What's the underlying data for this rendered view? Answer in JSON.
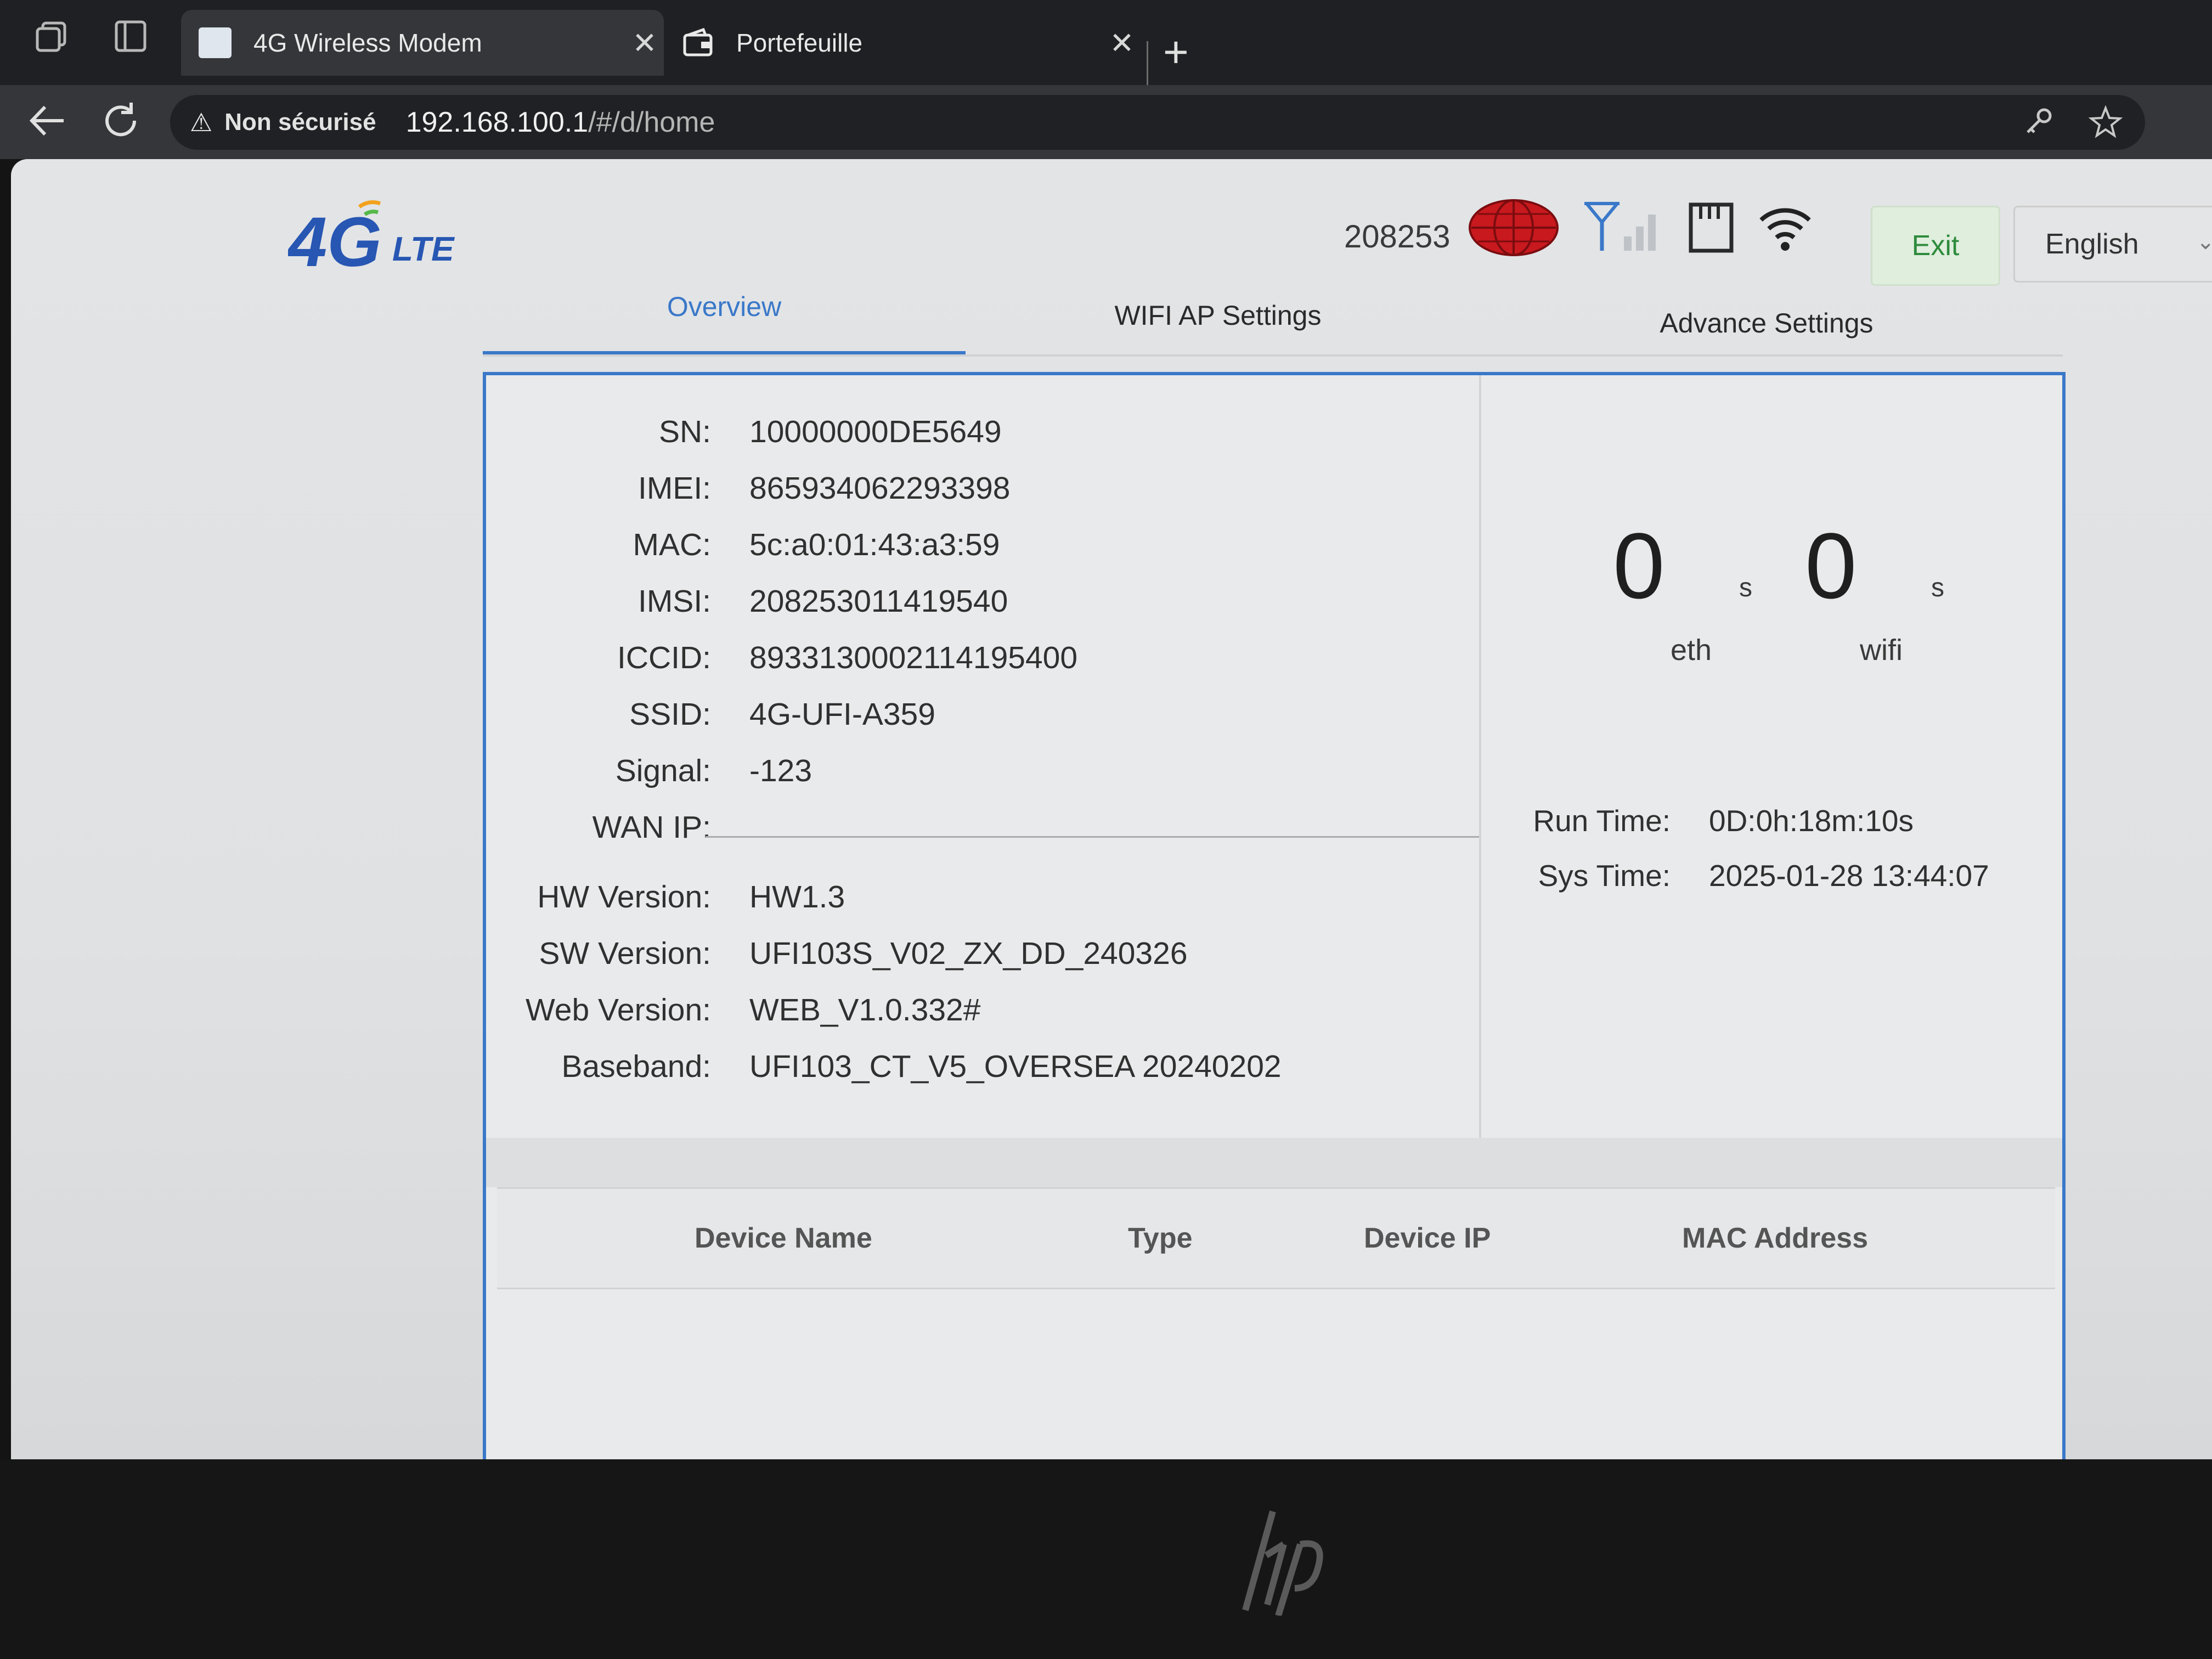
{
  "browser": {
    "tabs": [
      {
        "title": "4G Wireless Modem",
        "active": true
      },
      {
        "title": "Portefeuille",
        "active": false
      }
    ],
    "close_glyph": "✕",
    "new_tab_glyph": "+",
    "security_text": "Non sécurisé",
    "url_host": "192.168.100.1",
    "url_path": "/#/d/home"
  },
  "header": {
    "operator_code": "208253",
    "exit_label": "Exit",
    "language": "English",
    "icons": [
      "globe-icon",
      "signal-icon",
      "sim-card-icon",
      "wifi-icon"
    ]
  },
  "nav": {
    "tabs": [
      "Overview",
      "WIFI AP Settings",
      "Advance Settings"
    ],
    "active_tab": "Overview"
  },
  "device_info": {
    "rows": [
      {
        "label": "SN:",
        "value": "10000000DE5649"
      },
      {
        "label": "IMEI:",
        "value": "865934062293398"
      },
      {
        "label": "MAC:",
        "value": "5c:a0:01:43:a3:59"
      },
      {
        "label": "IMSI:",
        "value": "208253011419540"
      },
      {
        "label": "ICCID:",
        "value": "8933130002114195400"
      },
      {
        "label": "SSID:",
        "value": "4G-UFI-A359"
      },
      {
        "label": "Signal:",
        "value": "-123"
      },
      {
        "label": "WAN IP:",
        "value": ""
      }
    ],
    "version_rows": [
      {
        "label": "HW Version:",
        "value": "HW1.3"
      },
      {
        "label": "SW Version:",
        "value": "UFI103S_V02_ZX_DD_240326"
      },
      {
        "label": "Web Version:",
        "value": "WEB_V1.0.332#"
      },
      {
        "label": "Baseband:",
        "value": "UFI103_CT_V5_OVERSEA 20240202"
      }
    ]
  },
  "clients": {
    "eth": {
      "count": "0",
      "unit": "s",
      "label": "eth"
    },
    "wifi": {
      "count": "0",
      "unit": "s",
      "label": "wifi"
    }
  },
  "time": {
    "run_time_label": "Run Time:",
    "run_time": "0D:0h:18m:10s",
    "sys_time_label": "Sys Time:",
    "sys_time": "2025-01-28 13:44:07"
  },
  "device_table": {
    "columns": [
      "Device Name",
      "Type",
      "Device IP",
      "MAC Address"
    ],
    "rows": []
  },
  "colors": {
    "accent": "#3a78c9",
    "exit_green": "#2e8b3c",
    "globe_red": "#c8191e"
  }
}
